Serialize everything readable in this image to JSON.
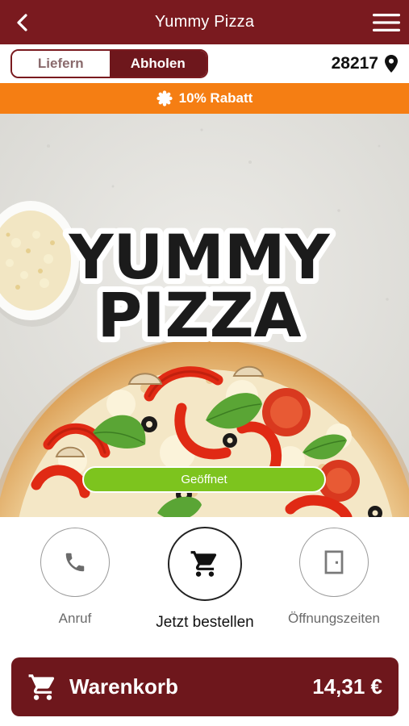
{
  "header": {
    "title": "Yummy Pizza",
    "back_icon": "chevron-left-icon",
    "menu_icon": "hamburger-menu-icon"
  },
  "mode": {
    "options": [
      "Liefern",
      "Abholen"
    ],
    "selected": "Abholen"
  },
  "location": {
    "zip": "28217",
    "icon": "map-pin-icon"
  },
  "promo": {
    "text": "10% Rabatt",
    "icon": "badge-icon"
  },
  "hero": {
    "logo_line1": "YUMMY",
    "logo_line2": "PIZZA",
    "status": "Geöffnet"
  },
  "actions": [
    {
      "label": "Anruf",
      "icon": "phone-icon"
    },
    {
      "label": "Jetzt bestellen",
      "icon": "cart-icon"
    },
    {
      "label": "Öffnungszeiten",
      "icon": "door-icon"
    }
  ],
  "cart": {
    "label": "Warenkorb",
    "total": "14,31 €",
    "icon": "cart-icon"
  },
  "colors": {
    "brand": "#7a1a1f",
    "promo": "#f57e13",
    "open": "#7dc41e"
  }
}
